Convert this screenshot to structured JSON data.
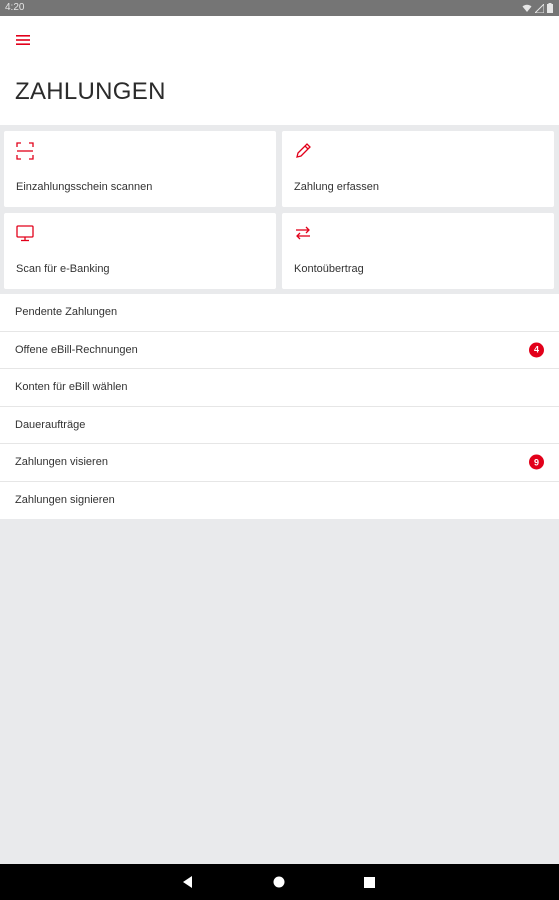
{
  "status_bar": {
    "time": "4:20",
    "icons": [
      "wifi-icon",
      "signal-icon",
      "battery-icon"
    ]
  },
  "header": {
    "menu_icon": "hamburger-menu-icon",
    "title": "ZAHLUNGEN"
  },
  "tiles": [
    {
      "label": "Einzahlungsschein scannen",
      "icon": "scan-icon"
    },
    {
      "label": "Zahlung erfassen",
      "icon": "pencil-icon"
    },
    {
      "label": "Scan für e-Banking",
      "icon": "monitor-icon"
    },
    {
      "label": "Kontoübertrag",
      "icon": "transfer-arrows-icon"
    }
  ],
  "list": [
    {
      "label": "Pendente Zahlungen"
    },
    {
      "label": "Offene eBill-Rechnungen",
      "badge": "4"
    },
    {
      "label": "Konten für eBill wählen"
    },
    {
      "label": "Daueraufträge"
    },
    {
      "label": "Zahlungen visieren",
      "badge": "9"
    },
    {
      "label": "Zahlungen signieren"
    }
  ],
  "nav_bar": {
    "buttons": [
      "back-icon",
      "home-icon",
      "recents-icon"
    ]
  },
  "colors": {
    "accent": "#e2001a",
    "background": "#e9eaec",
    "surface": "#ffffff",
    "status_bar": "#757575",
    "nav_bar": "#000000"
  }
}
